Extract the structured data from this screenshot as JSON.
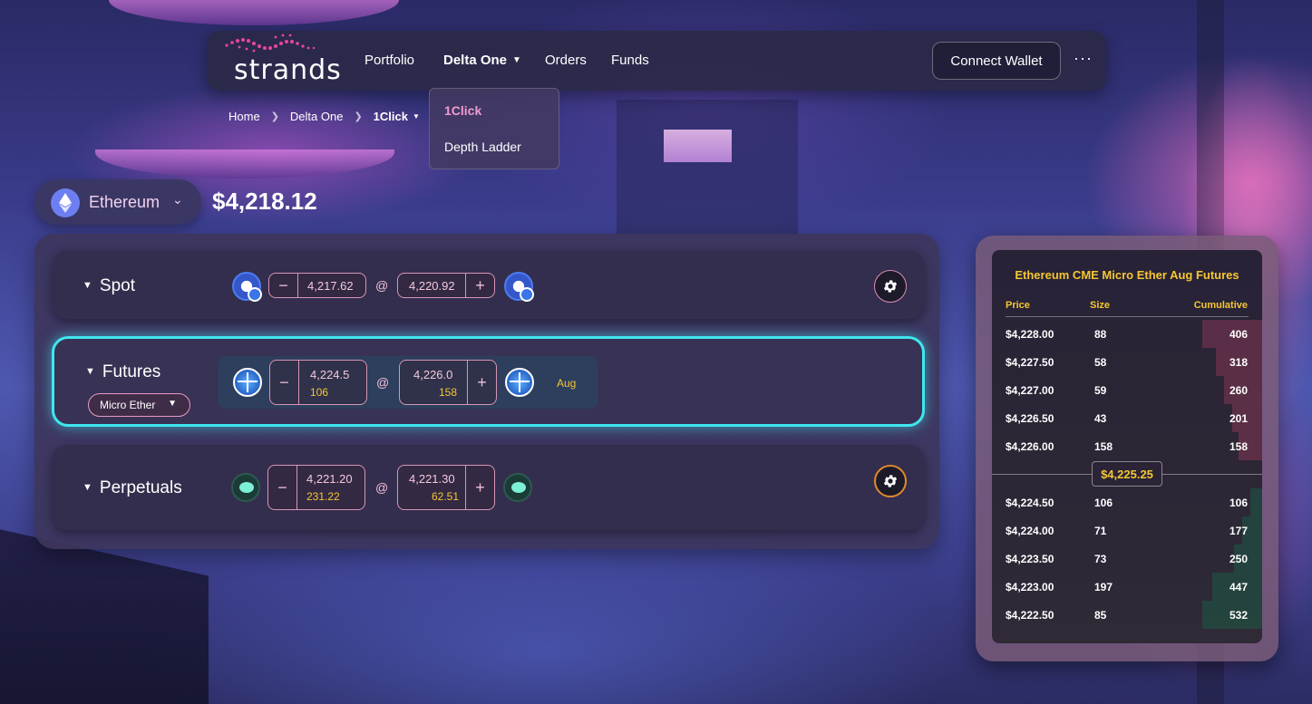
{
  "nav": {
    "logo_text": "strands",
    "links": [
      "Portfolio",
      "Delta One",
      "Orders",
      "Funds"
    ],
    "connect_wallet": "Connect Wallet",
    "more": "···",
    "dropdown": [
      "1Click",
      "Depth Ladder"
    ]
  },
  "breadcrumb": [
    "Home",
    "Delta One",
    "1Click"
  ],
  "asset": {
    "name": "Ethereum",
    "price": "$4,218.12"
  },
  "rows": {
    "spot": {
      "title": "Spot",
      "bid": "4,217.62",
      "ask": "4,220.92",
      "at": "@"
    },
    "futures": {
      "title": "Futures",
      "contract": "Micro Ether",
      "bid": "4,224.5",
      "bid_size": "106",
      "ask": "4,226.0",
      "ask_size": "158",
      "at": "@",
      "expiry": "Aug"
    },
    "perpetuals": {
      "title": "Perpetuals",
      "bid": "4,221.20",
      "bid_size": "231.22",
      "ask": "4,221.30",
      "ask_size": "62.51",
      "at": "@"
    }
  },
  "orderbook": {
    "title": "Ethereum CME Micro Ether Aug Futures",
    "headers": {
      "price": "Price",
      "size": "Size",
      "cumulative": "Cumulative"
    },
    "asks": [
      {
        "price": "$4,228.00",
        "size": "88",
        "cum": "406",
        "depth": 1.0
      },
      {
        "price": "$4,227.50",
        "size": "58",
        "cum": "318",
        "depth": 0.78
      },
      {
        "price": "$4,227.00",
        "size": "59",
        "cum": "260",
        "depth": 0.64
      },
      {
        "price": "$4,226.50",
        "size": "43",
        "cum": "201",
        "depth": 0.5
      },
      {
        "price": "$4,226.00",
        "size": "158",
        "cum": "158",
        "depth": 0.39
      }
    ],
    "mid": "$4,225.25",
    "bids": [
      {
        "price": "$4,224.50",
        "size": "106",
        "cum": "106",
        "depth": 0.2
      },
      {
        "price": "$4,224.00",
        "size": "71",
        "cum": "177",
        "depth": 0.33
      },
      {
        "price": "$4,223.50",
        "size": "73",
        "cum": "250",
        "depth": 0.47
      },
      {
        "price": "$4,223.00",
        "size": "197",
        "cum": "447",
        "depth": 0.84
      },
      {
        "price": "$4,222.50",
        "size": "85",
        "cum": "532",
        "depth": 1.0
      }
    ]
  },
  "colors": {
    "accent_cyan": "#3fe7ee",
    "accent_yellow": "#f5c633",
    "accent_pink": "#f39ad2",
    "gear_perp_ring": "#e08a2c"
  }
}
